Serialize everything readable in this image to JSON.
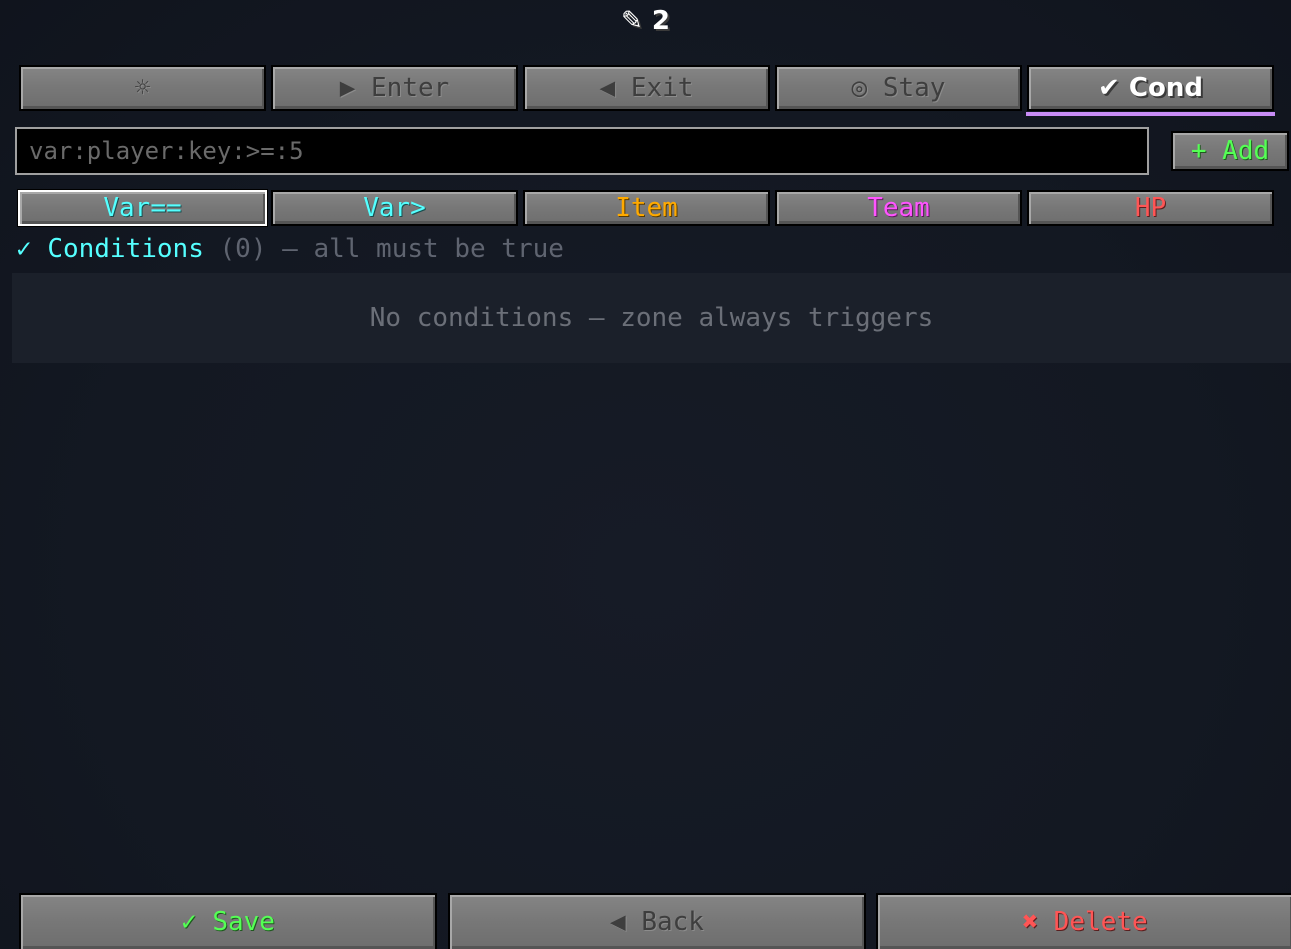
{
  "title": "✎ 2",
  "tabs": [
    {
      "label": "☼",
      "color": "#3e3e3e"
    },
    {
      "label": "▶ Enter",
      "color": "#3e3e3e"
    },
    {
      "label": "◀ Exit",
      "color": "#3e3e3e"
    },
    {
      "label": "◎ Stay",
      "color": "#3e3e3e"
    },
    {
      "label": "✔ Cond",
      "color": "#ffffff"
    }
  ],
  "active_tab": "✔ Cond",
  "condition_input": {
    "value": "",
    "placeholder": "var:player:key:>=:5"
  },
  "add_button": {
    "label": "+ Add",
    "color": "#55ff55"
  },
  "chips": [
    {
      "label": "Var==",
      "color": "#55ffff"
    },
    {
      "label": "Var>",
      "color": "#55ffff"
    },
    {
      "label": "Item",
      "color": "#ffaa00"
    },
    {
      "label": "Team",
      "color": "#ff55ff"
    },
    {
      "label": "HP",
      "color": "#ff5555"
    }
  ],
  "conditions_header": {
    "check": "✓",
    "label": "Conditions",
    "count": "(0)",
    "suffix": "— all must be true"
  },
  "empty_message": "No conditions — zone always triggers",
  "footer": {
    "save": {
      "label": "✓ Save",
      "color": "#55ff55"
    },
    "back": {
      "label": "◀ Back",
      "color": "#3e3e3e"
    },
    "delete": {
      "label": "✖ Delete",
      "color": "#ff5555"
    }
  }
}
